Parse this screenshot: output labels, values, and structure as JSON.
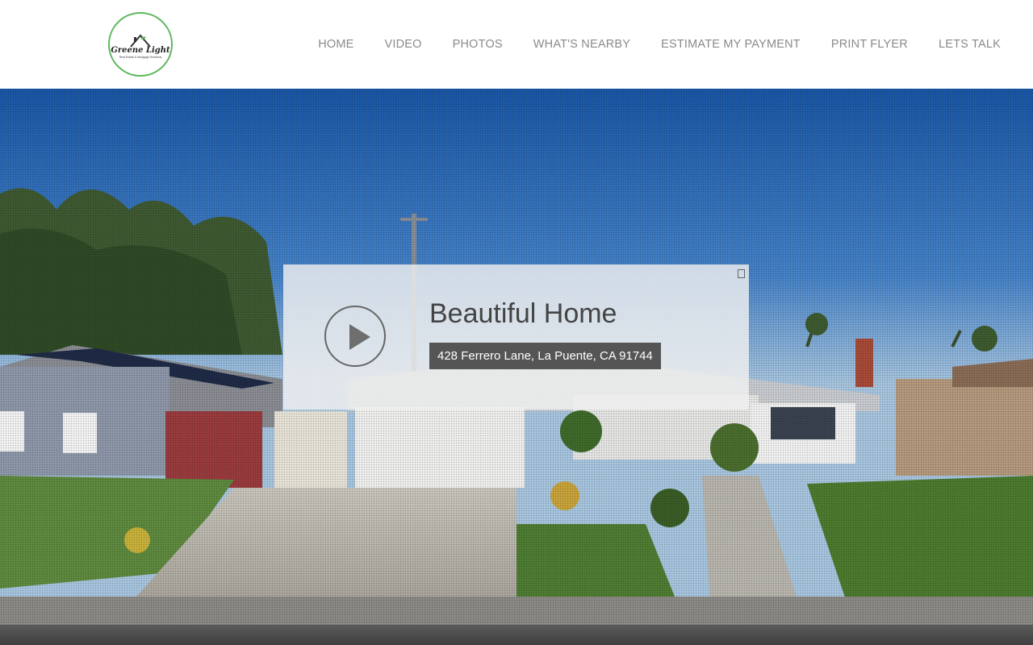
{
  "header": {
    "logo": {
      "name": "Greene Light",
      "tagline": "Real Estate & Mortgage Solutions",
      "color": "#5cb85c"
    },
    "nav": [
      {
        "label": "HOME"
      },
      {
        "label": "VIDEO"
      },
      {
        "label": "PHOTOS"
      },
      {
        "label": "WHAT'S NEARBY"
      },
      {
        "label": "ESTIMATE MY PAYMENT"
      },
      {
        "label": "PRINT FLYER"
      },
      {
        "label": "LETS TALK"
      }
    ]
  },
  "hero": {
    "title": "Beautiful Home",
    "address": "428 Ferrero Lane, La Puente, CA 91744",
    "play_icon": "play-icon",
    "close_icon": "close-icon"
  },
  "colors": {
    "nav_text": "#8a8a8a",
    "address_bg": "#555555",
    "title_text": "#444444"
  }
}
